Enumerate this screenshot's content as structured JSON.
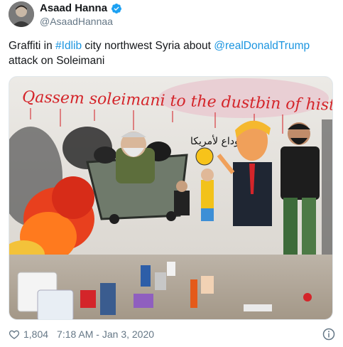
{
  "tweet": {
    "author": {
      "display_name": "Asaad Hanna",
      "handle": "@AsaadHannaa",
      "verified": true
    },
    "text_prefix": "Graffiti in ",
    "hashtag": "#Idlib",
    "text_middle": " city northwest Syria about ",
    "mention": "@realDonaldTrump",
    "text_suffix": " attack on Soleimani",
    "media": {
      "graffiti_headline": "Qassem soleimani to the dustbin of history",
      "arabic_text": "الوداع لأمريكا"
    },
    "likes": "1,804",
    "timestamp": "7:18 AM - Jan 3, 2020"
  },
  "colors": {
    "link": "#1b95e0",
    "secondary_text": "#657786",
    "verified_badge": "#1da1f2",
    "graffiti_red": "#d4252a"
  },
  "icons": {
    "verified": "verified-badge-icon",
    "like": "heart-icon",
    "info": "info-icon"
  }
}
